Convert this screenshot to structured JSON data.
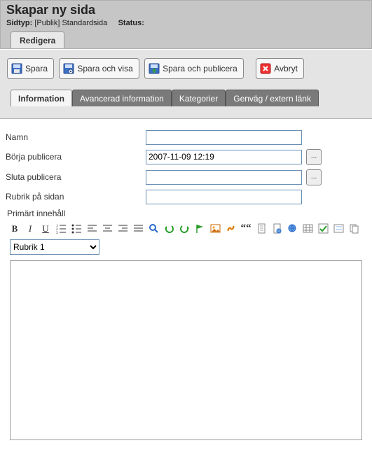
{
  "header": {
    "title": "Skapar ny sida",
    "sidtyp_label": "Sidtyp:",
    "sidtyp_value": "[Publik] Standardsida",
    "status_label": "Status:",
    "edit_tab": "Redigera"
  },
  "actions": {
    "save": "Spara",
    "save_show": "Spara och visa",
    "save_publish": "Spara och publicera",
    "cancel": "Avbryt"
  },
  "tabs": {
    "info": "Information",
    "adv": "Avancerad information",
    "cat": "Kategorier",
    "shortcut": "Genväg / extern länk"
  },
  "form": {
    "name_label": "Namn",
    "name_value": "",
    "pub_start_label": "Börja publicera",
    "pub_start_value": "2007-11-09 12:19",
    "pub_end_label": "Sluta publicera",
    "pub_end_value": "",
    "page_title_label": "Rubrik på sidan",
    "page_title_value": "",
    "primary_content_label": "Primärt innehåll"
  },
  "editor": {
    "style_selected": "Rubrik 1",
    "content": "",
    "ellipsis": "..."
  }
}
